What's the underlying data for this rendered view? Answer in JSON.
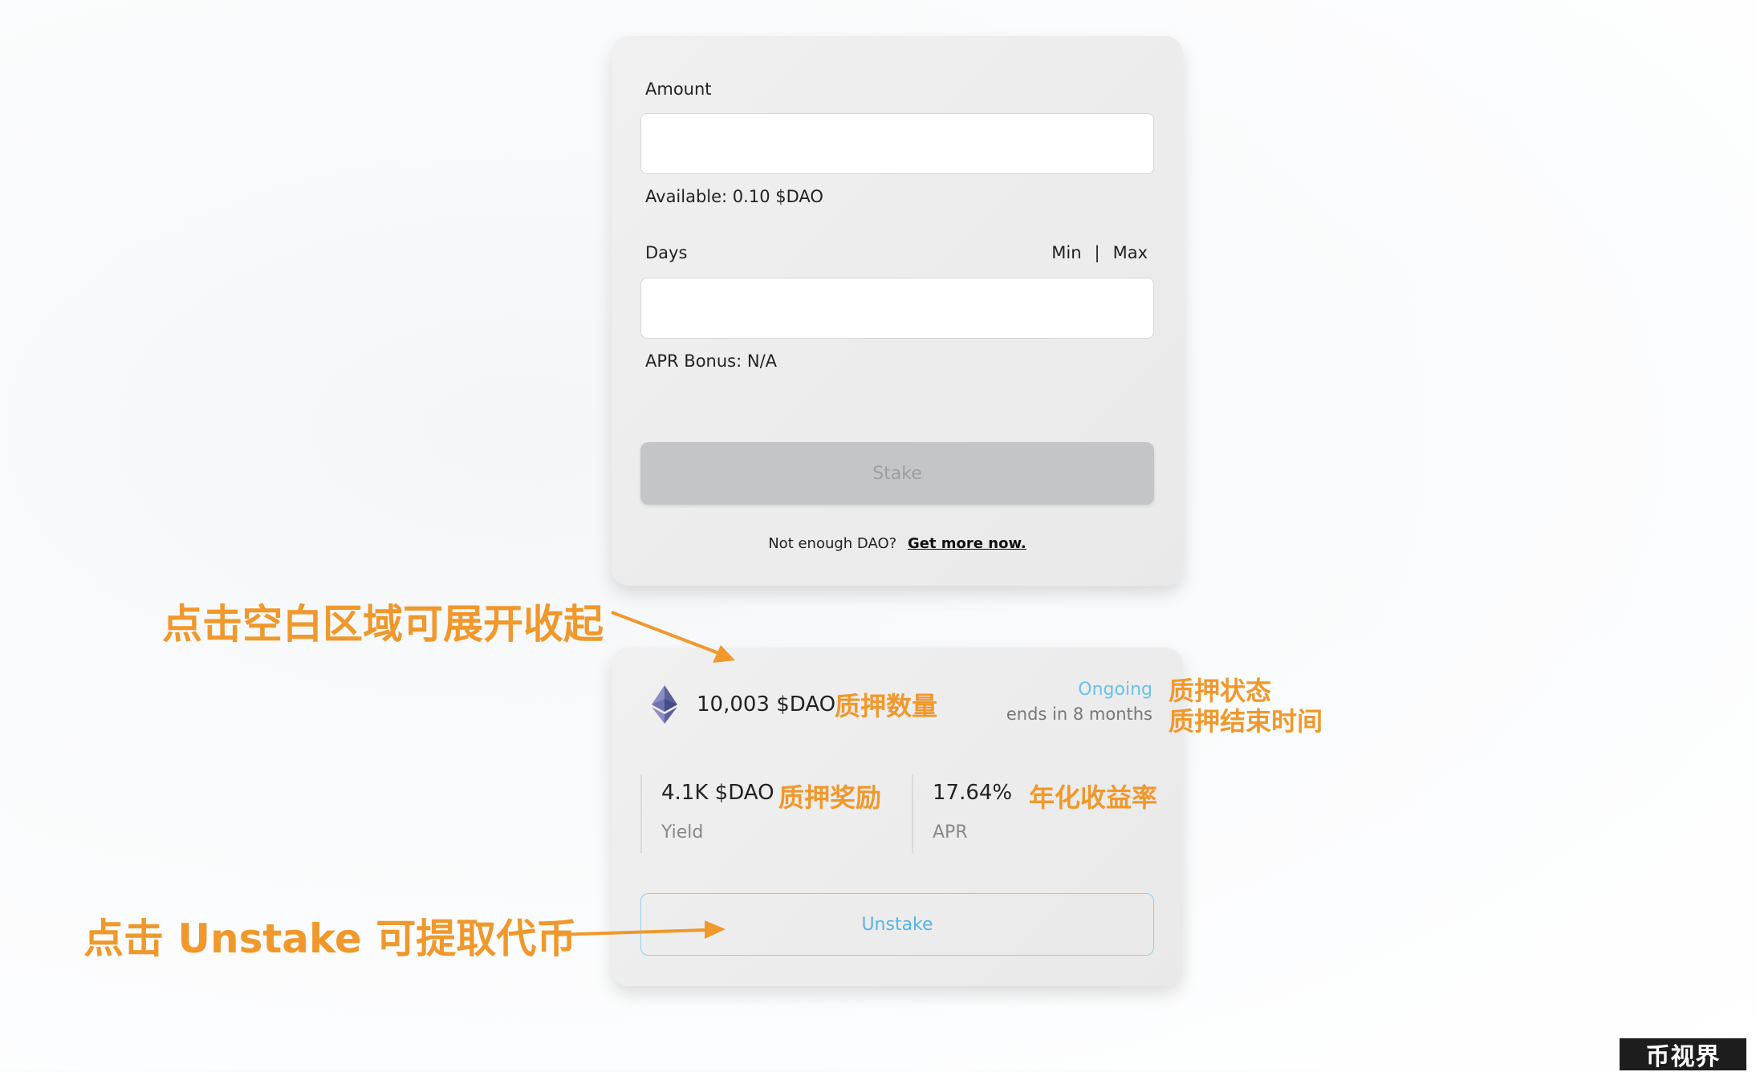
{
  "stake_form": {
    "amount_label": "Amount",
    "amount_value": "",
    "available_text": "Available: 0.10 $DAO",
    "days_label": "Days",
    "min_label": "Min",
    "separator": "|",
    "max_label": "Max",
    "days_value": "",
    "apr_bonus_text": "APR Bonus: N/A",
    "stake_button": "Stake",
    "promo_text": "Not enough DAO?",
    "promo_link": "Get more now."
  },
  "position": {
    "token_icon": "ethereum-icon",
    "amount": "10,003 $DAO",
    "status": "Ongoing",
    "ends": "ends in 8 months",
    "yield_value": "4.1K $DAO",
    "yield_label": "Yield",
    "apr_value": "17.64%",
    "apr_label": "APR",
    "unstake_button": "Unstake"
  },
  "annotations": {
    "expand_collapse": "点击空白区域可展开收起",
    "stake_amount": "质押数量",
    "stake_status": "质押状态",
    "stake_end_time": "质押结束时间",
    "stake_reward": "质押奖励",
    "annual_yield": "年化收益率",
    "unstake_hint": "点击 Unstake 可提取代币",
    "color": "#f0982c"
  },
  "watermark": "币视界",
  "colors": {
    "accent_blue": "#56b4e6",
    "disabled_button": "#c4c5c9",
    "annotation_orange": "#f0982c"
  }
}
